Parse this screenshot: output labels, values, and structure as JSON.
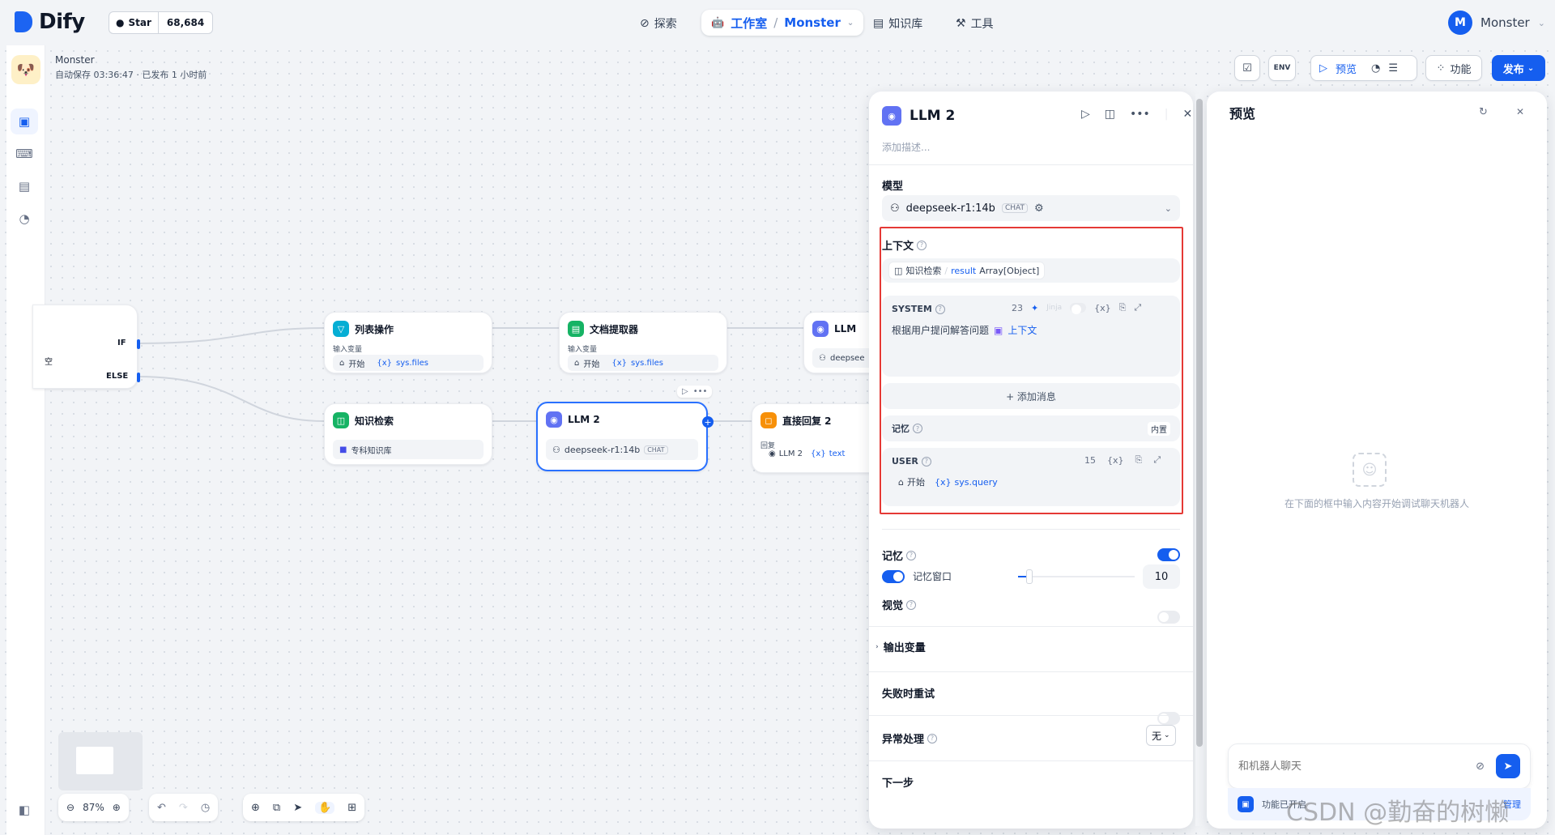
{
  "topbar": {
    "logo": "Dify",
    "github_star": "Star",
    "github_count": "68,684",
    "nav_explore": "探索",
    "nav_studio": "工作室",
    "nav_app": "Monster",
    "nav_knowledge": "知识库",
    "nav_tools": "工具",
    "user_initial": "M",
    "user_name": "Monster"
  },
  "app": {
    "name": "Monster",
    "status": "自动保存 03:36:47 · 已发布 1 小时前"
  },
  "toolbar": {
    "env": "ENV",
    "preview": "预览",
    "features": "功能",
    "publish": "发布"
  },
  "canvas": {
    "if_label": "IF",
    "else_label": "ELSE",
    "left_partial": "空",
    "zoom": "87%",
    "nodes": {
      "list_op": {
        "title": "列表操作",
        "sub": "输入变量",
        "src": "开始",
        "var": "sys.files"
      },
      "doc_extract": {
        "title": "文档提取器",
        "sub": "输入变量",
        "src": "开始",
        "var": "sys.files"
      },
      "llm1": {
        "title": "LLM",
        "model": "deepsee"
      },
      "knowledge": {
        "title": "知识检索",
        "kb": "专科知识库"
      },
      "llm2": {
        "title": "LLM 2",
        "model": "deepseek-r1:14b",
        "tag": "CHAT"
      },
      "answer2": {
        "title": "直接回复 2",
        "sub": "回复",
        "src": "LLM 2",
        "var": "text"
      }
    }
  },
  "panel": {
    "title": "LLM 2",
    "desc_placeholder": "添加描述...",
    "model_label": "模型",
    "model_name": "deepseek-r1:14b",
    "model_tag": "CHAT",
    "context_label": "上下文",
    "context_src": "知识检索",
    "context_var": "result",
    "context_type": "Array[Object]",
    "system_label": "SYSTEM",
    "system_count": "23",
    "jinja": "Jinja",
    "system_text": "根据用户提问解答问题",
    "system_ctx": "上下文",
    "add_message": "+ 添加消息",
    "memory_label_inner": "记忆",
    "memory_builtin": "内置",
    "user_label": "USER",
    "user_count": "15",
    "user_src": "开始",
    "user_var": "sys.query",
    "memory_label": "记忆",
    "memory_window": "记忆窗口",
    "memory_window_value": "10",
    "memory_slider_fraction": 0.1,
    "vision_label": "视觉",
    "output_vars": "输出变量",
    "retry_label": "失败时重试",
    "error_label": "异常处理",
    "error_value": "无",
    "next_step": "下一步"
  },
  "preview": {
    "title": "预览",
    "empty_hint": "在下面的框中输入内容开始调试聊天机器人",
    "chat_placeholder": "和机器人聊天",
    "features_on": "功能已开启",
    "manage": "管理"
  },
  "watermark": "CSDN @勤奋的树懒",
  "colors": {
    "accent": "#155eef",
    "highlight_border": "#e53935"
  }
}
